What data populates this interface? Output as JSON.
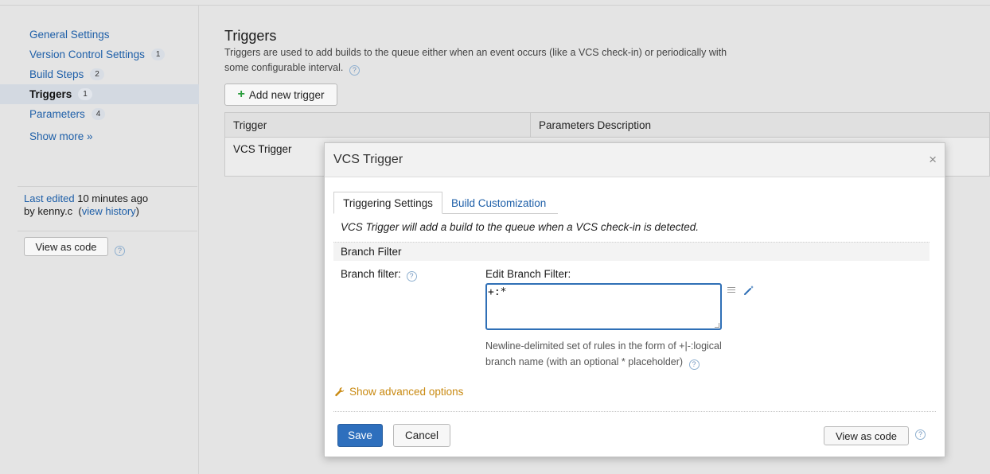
{
  "sidebar": {
    "items": [
      {
        "label": "General Settings",
        "badge": ""
      },
      {
        "label": "Version Control Settings",
        "badge": "1"
      },
      {
        "label": "Build Steps",
        "badge": "2"
      },
      {
        "label": "Triggers",
        "badge": "1",
        "active": true
      },
      {
        "label": "Parameters",
        "badge": "4"
      }
    ],
    "show_more": "Show more »",
    "last_edited_label": "Last edited",
    "last_edited_time": "10 minutes ago",
    "by_user": "by kenny.c",
    "view_history": "view history",
    "view_as_code": "View as code"
  },
  "main": {
    "title": "Triggers",
    "description": "Triggers are used to add builds to the queue either when an event occurs (like a VCS check-in) or periodically with some configurable interval.",
    "add_trigger": "Add new trigger",
    "table": {
      "headers": [
        "Trigger",
        "Parameters Description"
      ],
      "rows": [
        [
          "VCS Trigger",
          ""
        ]
      ]
    }
  },
  "dialog": {
    "title": "VCS Trigger",
    "close": "×",
    "tabs": [
      "Triggering Settings",
      "Build Customization"
    ],
    "intro": "VCS Trigger will add a build to the queue when a VCS check-in is detected.",
    "section": "Branch Filter",
    "branch_filter_label": "Branch filter:",
    "edit_label": "Edit Branch Filter:",
    "branch_filter_value": "+:*",
    "note": "Newline-delimited set of rules in the form of +|-:logical branch name (with an optional * placeholder)",
    "advanced": "Show advanced options",
    "save": "Save",
    "cancel": "Cancel",
    "view_as_code": "View as code"
  },
  "icons": {
    "help": "?",
    "plus": "+",
    "wrench": "wrench-icon",
    "wand": "magic-wand-icon",
    "list": "list-icon"
  },
  "colors": {
    "accent": "#2e6fbd",
    "link": "#1e5fa8",
    "advanced": "#c98a12",
    "add": "#2a9d3c"
  }
}
